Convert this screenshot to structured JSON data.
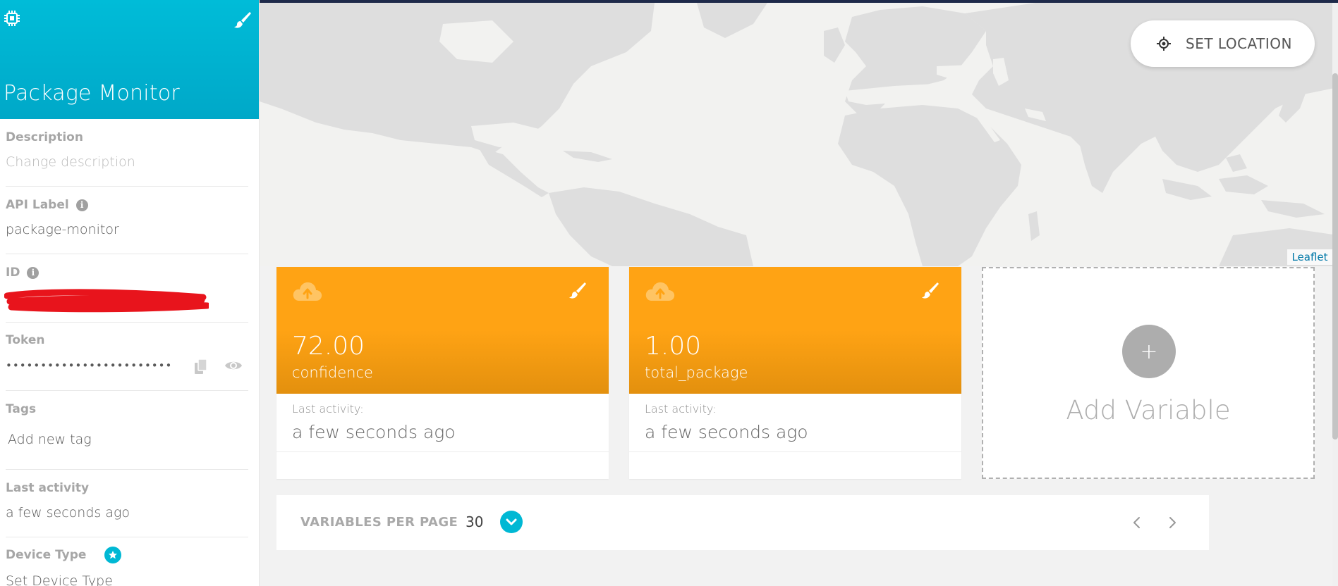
{
  "device": {
    "title": "Package Monitor",
    "chip_icon": "chip-icon",
    "edit_icon": "paintbrush-icon"
  },
  "fields": {
    "description": {
      "label": "Description",
      "placeholder": "Change description"
    },
    "api_label": {
      "label": "API Label",
      "value": "package-monitor"
    },
    "id": {
      "label": "ID"
    },
    "token": {
      "label": "Token",
      "value": "••••••••••••••••••••••••"
    },
    "tags": {
      "label": "Tags",
      "add_label": "Add new tag"
    },
    "last_activity": {
      "label": "Last activity",
      "value": "a few seconds ago"
    },
    "device_type": {
      "label": "Device Type",
      "value": "Set Device Type"
    }
  },
  "map": {
    "set_location": "SET LOCATION",
    "attribution": "Leaflet"
  },
  "variables": [
    {
      "value": "72.00",
      "name": "confidence",
      "last_activity_label": "Last activity:",
      "last_activity": "a few seconds ago"
    },
    {
      "value": "1.00",
      "name": "total_package",
      "last_activity_label": "Last activity:",
      "last_activity": "a few seconds ago"
    }
  ],
  "add_variable": {
    "label": "Add Variable",
    "plus": "+"
  },
  "pagination": {
    "label": "VARIABLES PER PAGE",
    "per_page": "30"
  },
  "colors": {
    "header": "#00b8d4",
    "card": "#ffa314",
    "accent": "#00b8d4"
  }
}
